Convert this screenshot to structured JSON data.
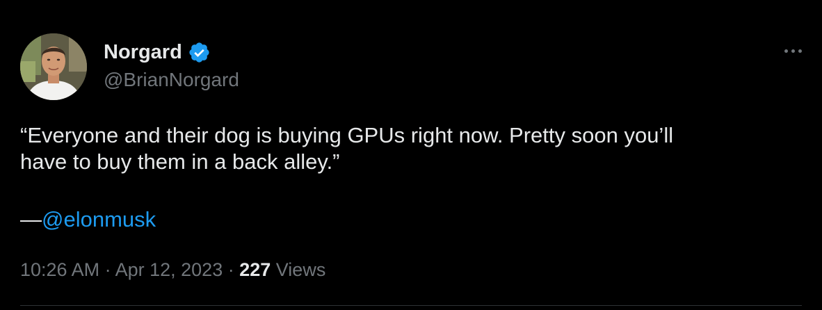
{
  "author": {
    "display_name": "Norgard",
    "handle": "@BrianNorgard",
    "verified_icon": "verified-badge-icon",
    "avatar_icon": "profile-photo-avatar"
  },
  "tweet": {
    "line1": "“Everyone and their dog is buying GPUs right now. Pretty soon you’ll",
    "line2": "have to buy them in a back alley.”",
    "attribution_dash": "—",
    "mention": "@elonmusk"
  },
  "meta": {
    "time": "10:26 AM",
    "separator": " · ",
    "date": "Apr 12, 2023",
    "views_count": "227",
    "views_label": " Views"
  },
  "colors": {
    "background": "#000000",
    "text_primary": "#e7e9ea",
    "text_secondary": "#71767b",
    "link": "#1d9bf0",
    "verified": "#1d9bf0",
    "divider": "#2f3336"
  }
}
